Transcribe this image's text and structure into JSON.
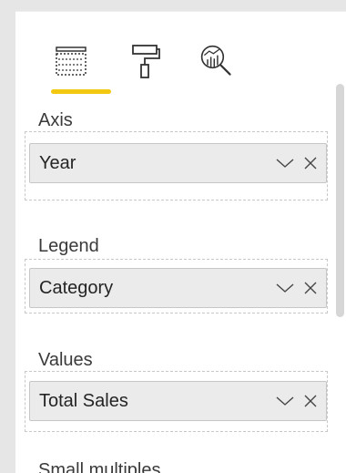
{
  "toolbar": {
    "tabs": [
      {
        "icon": "fields-icon",
        "active": true
      },
      {
        "icon": "format-paint-roller-icon",
        "active": false
      },
      {
        "icon": "analytics-magnifier-icon",
        "active": false
      }
    ],
    "accent_color": "#f2c811"
  },
  "wells": {
    "axis": {
      "label": "Axis",
      "field": "Year"
    },
    "legend": {
      "label": "Legend",
      "field": "Category"
    },
    "values": {
      "label": "Values",
      "field": "Total Sales"
    },
    "small_multiples": {
      "label": "Small multiples"
    }
  }
}
